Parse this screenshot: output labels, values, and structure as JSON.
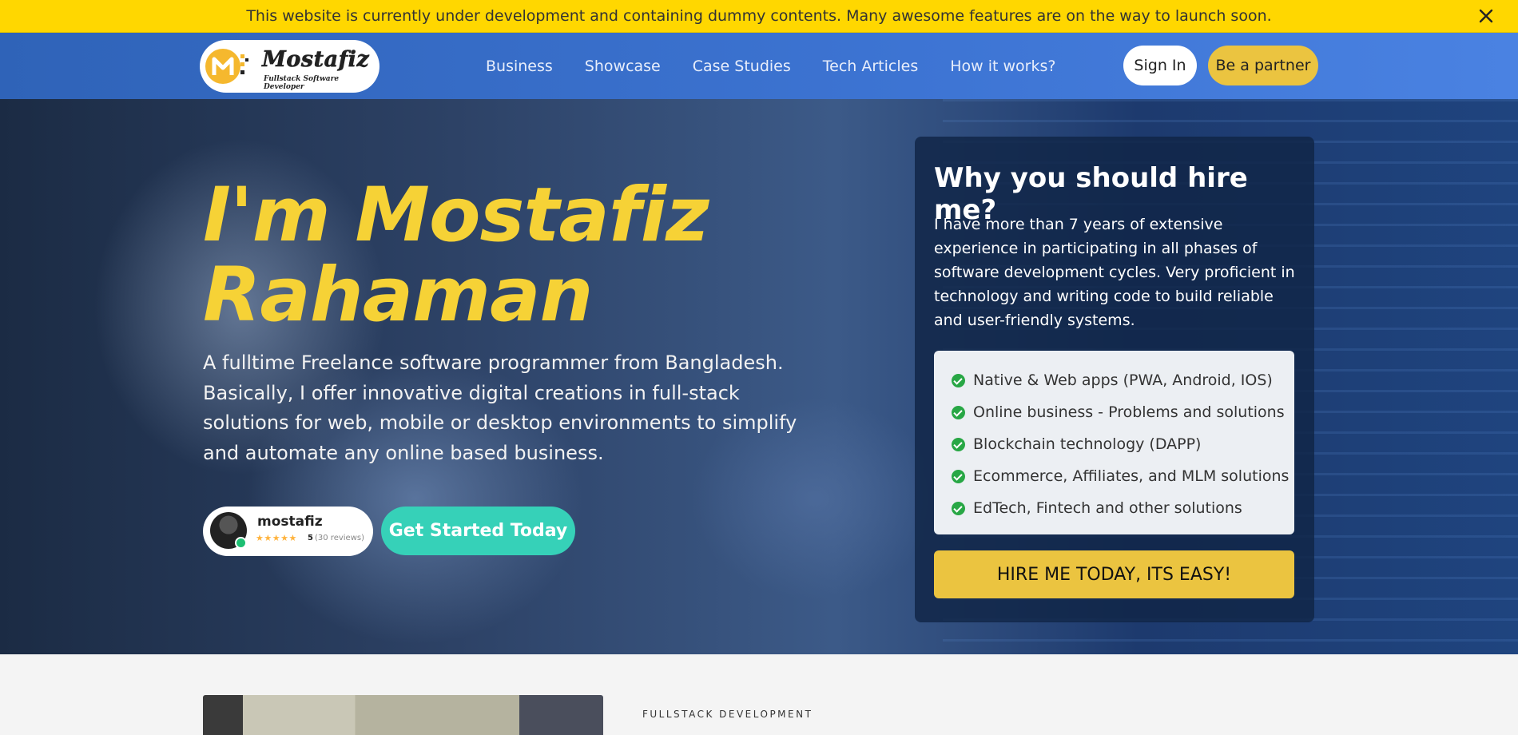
{
  "announcement": {
    "text": "This website is currently under development and containing dummy contents. Many awesome features are on the way to launch soon."
  },
  "header": {
    "logo": {
      "name": "Mostafiz",
      "tagline": "Fullstack Software Developer"
    },
    "nav": [
      "Business",
      "Showcase",
      "Case Studies",
      "Tech Articles",
      "How it works?"
    ],
    "sign_in": "Sign In",
    "partner": "Be a partner"
  },
  "hero": {
    "title_line1": "I'm Mostafiz",
    "title_line2": "Rahaman",
    "description": "A fulltime Freelance software programmer from Bangladesh. Basically, I offer innovative digital creations in full-stack solutions for web, mobile or desktop environments to simplify and automate any online based business.",
    "profile": {
      "name": "mostafiz",
      "stars": "★★★★★",
      "rating": "5",
      "reviews": "(30 reviews)"
    },
    "cta": "Get Started Today"
  },
  "hire_card": {
    "title": "Why you should hire me?",
    "intro": "I have more than 7 years of extensive experience in participating in all phases of software development cycles. Very proficient in technology and writing code to build reliable and user-friendly systems.",
    "services": [
      "Native & Web apps (PWA, Android, IOS)",
      "Online business - Problems and solutions",
      "Blockchain technology (DAPP)",
      "Ecommerce, Affiliates, and MLM solutions",
      "EdTech, Fintech and other solutions"
    ],
    "button": "HIRE ME TODAY, ITS EASY!"
  },
  "lower": {
    "eyebrow": "FULLSTACK DEVELOPMENT"
  },
  "colors": {
    "announcement": "#ffd700",
    "header": "#3d74d3",
    "accent_yellow": "#ebc440",
    "accent_teal": "#36d1b8",
    "title_yellow": "#f6d236"
  }
}
